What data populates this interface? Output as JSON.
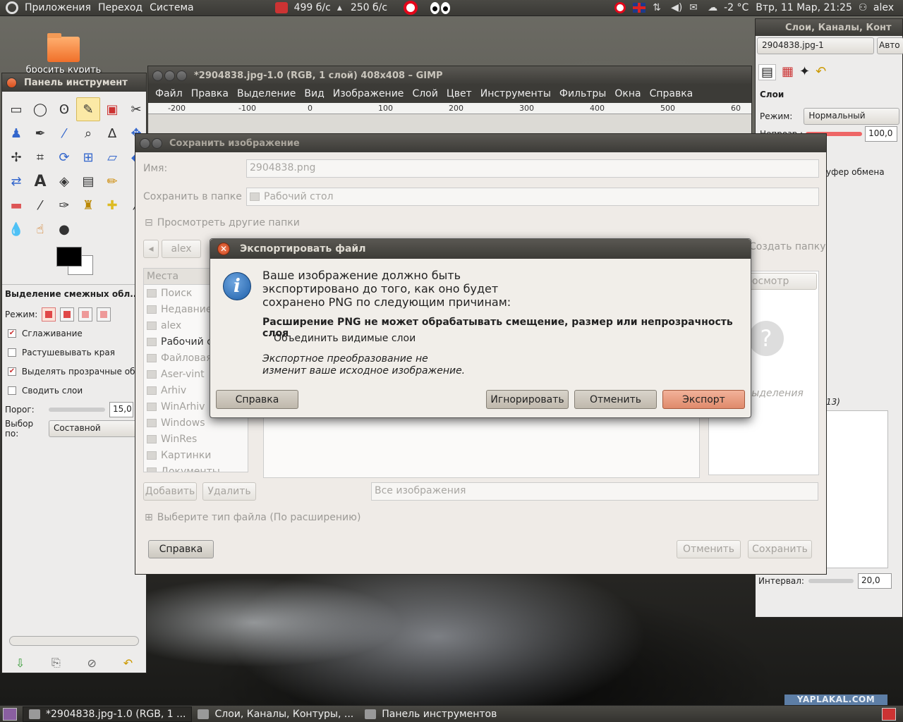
{
  "top_panel": {
    "menus": [
      "Приложения",
      "Переход",
      "Система"
    ],
    "net_down": "499 б/с",
    "net_up": "250 б/с",
    "weather": "-2 °C",
    "datetime": "Втр, 11 Мар, 21:25",
    "user": "alex"
  },
  "desktop": {
    "icon_label": "бросить курить"
  },
  "toolbox": {
    "title": "Панель инструмент",
    "options_title": "Выделение смежных обл...",
    "mode_label": "Режим:",
    "antialias": "Сглаживание",
    "feather": "Растушевывать края",
    "select_transparent": "Выделять прозрачные обла",
    "sample_merged": "Сводить слои",
    "threshold_label": "Порог:",
    "threshold_value": "15,0",
    "select_by_label": "Выбор по:",
    "select_by_value": "Составной"
  },
  "gimp_window": {
    "title": "*2904838.jpg-1.0 (RGB, 1 слой) 408x408 – GIMP",
    "menu": [
      "Файл",
      "Правка",
      "Выделение",
      "Вид",
      "Изображение",
      "Слой",
      "Цвет",
      "Инструменты",
      "Фильтры",
      "Окна",
      "Справка"
    ],
    "ruler": [
      "-200",
      "-100",
      "0",
      "100",
      "200",
      "300",
      "400",
      "500",
      "60"
    ]
  },
  "save_dialog": {
    "title": "Сохранить изображение",
    "name_label": "Имя:",
    "name_value": "2904838.png",
    "folder_label": "Сохранить в папке",
    "folder_value": "Рабочий стол",
    "browse_label": "Просмотреть другие папки",
    "path_button": "alex",
    "create_folder": "Создать папку",
    "places_header": "Места",
    "places": [
      "Поиск",
      "Недавние",
      "alex",
      "Рабочий ст",
      "Файловая",
      "Aser-vint",
      "Arhiv",
      "WinArhiv",
      "Windows",
      "WinRes",
      "Картинки",
      "Документы"
    ],
    "preview": "Просмотр",
    "no_selection": "выделения",
    "add": "Добавить",
    "remove": "Удалить",
    "filter": "Все изображения",
    "file_type": "Выберите тип файла (По расширению)",
    "help": "Справка",
    "cancel": "Отменить",
    "save": "Сохранить"
  },
  "dock": {
    "title": "Слои, Каналы, Конт",
    "image_combo": "2904838.jpg-1",
    "auto": "Авто",
    "layers_header": "Слои",
    "mode_label": "Режим:",
    "mode_value": "Нормальный",
    "opacity_label": "Непрозр.:",
    "opacity_value": "100,0",
    "clipboard": "уфер обмена",
    "brushes_count": "13)",
    "spacing_label": "Интервал:",
    "spacing_value": "20,0"
  },
  "export_dialog": {
    "title": "Экспортировать файл",
    "message": "Ваше изображение должно быть\nэкспортировано до того, как оно будет\nсохранено PNG по следующим причинам:",
    "reason": "Расширение PNG не может обрабатывать смещение, размер или непрозрачность слоя",
    "action": "Объединить видимые слои",
    "note": "Экспортное преобразование не\nизменит ваше исходное изображение.",
    "help": "Справка",
    "ignore": "Игнорировать",
    "cancel": "Отменить",
    "export": "Экспорт"
  },
  "taskbar": {
    "tasks": [
      "*2904838.jpg-1.0 (RGB, 1 ...",
      "Слои, Каналы, Контуры, ...",
      "Панель инструментов"
    ]
  },
  "watermark": "YAPLAKAL.COM"
}
